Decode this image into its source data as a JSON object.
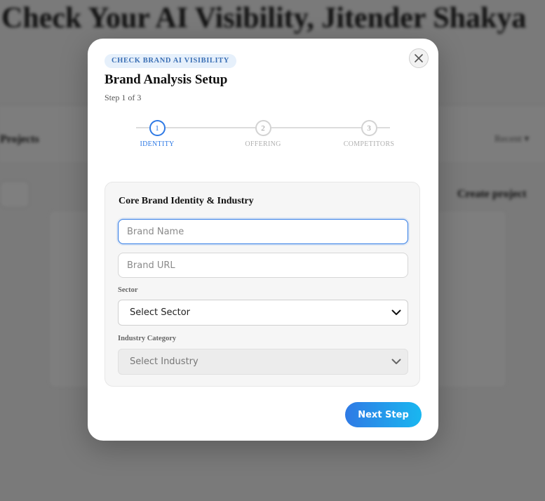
{
  "background": {
    "title": "Check Your AI Visibility, Jitender Shakya",
    "projects_label": "Projects",
    "recent_label": "Recent ▾",
    "create_project_label": "Create project"
  },
  "modal": {
    "badge": "CHECK BRAND AI VISIBILITY",
    "close_icon": "close-icon",
    "title": "Brand Analysis Setup",
    "step_count": "Step 1 of 3",
    "steps": [
      {
        "number": "1",
        "label": "IDENTITY",
        "active": true
      },
      {
        "number": "2",
        "label": "OFFERING",
        "active": false
      },
      {
        "number": "3",
        "label": "COMPETITORS",
        "active": false
      }
    ],
    "form": {
      "title": "Core Brand Identity & Industry",
      "brand_name": {
        "placeholder": "Brand Name",
        "value": ""
      },
      "brand_url": {
        "placeholder": "Brand URL",
        "value": ""
      },
      "sector_label": "Sector",
      "sector_value": "Select Sector",
      "industry_label": "Industry Category",
      "industry_value": "Select Industry"
    },
    "next_label": "Next Step"
  },
  "colors": {
    "accent": "#2f7ae5",
    "accent_gradient_end": "#19b7f0",
    "badge_bg": "#e6f0fb",
    "overlay": "rgba(0,0,0,0.5)"
  }
}
